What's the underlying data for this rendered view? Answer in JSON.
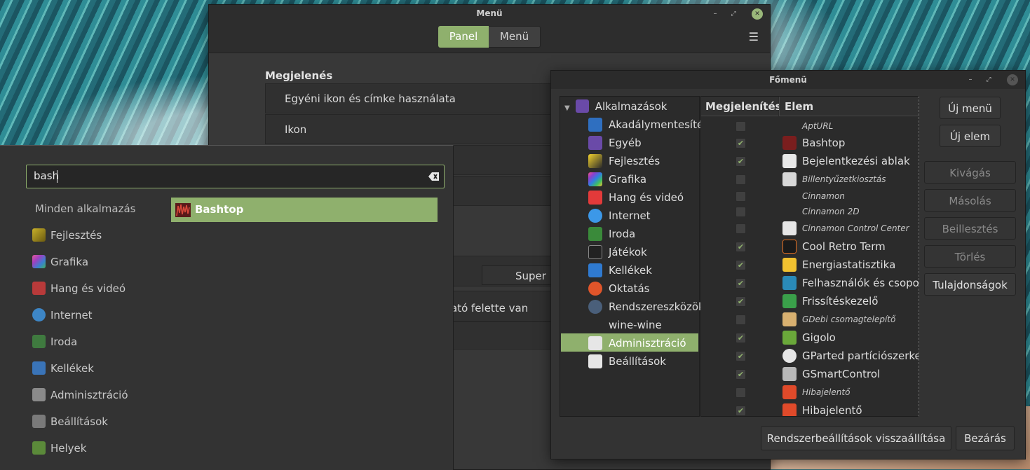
{
  "menu_window": {
    "title": "Menü",
    "tabs": [
      "Panel",
      "Menü"
    ],
    "section_title": "Megjelenés",
    "rows": [
      "Egyéni ikon és címke használata",
      "Ikon"
    ],
    "super_label": "Super L",
    "partial_text": "ató felette van"
  },
  "start_menu": {
    "search_value": "bash",
    "all_apps": "Minden alkalmazás",
    "categories": [
      "Fejlesztés",
      "Grafika",
      "Hang és videó",
      "Internet",
      "Iroda",
      "Kellékek",
      "Adminisztráció",
      "Beállítások",
      "Helyek"
    ],
    "result": "Bashtop"
  },
  "editor": {
    "title": "Főmenü",
    "tree_root": "Alkalmazások",
    "tree_items": [
      "Akadálymentesítés",
      "Egyéb",
      "Fejlesztés",
      "Grafika",
      "Hang és videó",
      "Internet",
      "Iroda",
      "Játékok",
      "Kellékek",
      "Oktatás",
      "Rendszereszközök",
      "wine-wine",
      "Adminisztráció",
      "Beállítások"
    ],
    "columns": [
      "Megjelenítés",
      "Elem"
    ],
    "items": [
      {
        "label": "AptURL",
        "checked": false,
        "italic": true
      },
      {
        "label": "Bashtop",
        "checked": true,
        "italic": false
      },
      {
        "label": "Bejelentkezési ablak",
        "checked": true,
        "italic": false
      },
      {
        "label": "Billentyűzetkiosztás",
        "checked": false,
        "italic": true
      },
      {
        "label": "Cinnamon",
        "checked": false,
        "italic": true
      },
      {
        "label": "Cinnamon 2D",
        "checked": false,
        "italic": true
      },
      {
        "label": "Cinnamon Control Center",
        "checked": false,
        "italic": true
      },
      {
        "label": "Cool Retro Term",
        "checked": true,
        "italic": false
      },
      {
        "label": "Energiastatisztika",
        "checked": true,
        "italic": false
      },
      {
        "label": "Felhasználók és csoportok",
        "checked": true,
        "italic": false
      },
      {
        "label": "Frissítéskezelő",
        "checked": true,
        "italic": false
      },
      {
        "label": "GDebi csomagtelepítő",
        "checked": false,
        "italic": true
      },
      {
        "label": "Gigolo",
        "checked": true,
        "italic": false
      },
      {
        "label": "GParted partíciószerkesztő",
        "checked": true,
        "italic": false
      },
      {
        "label": "GSmartControl",
        "checked": true,
        "italic": false
      },
      {
        "label": "Hibajelentő",
        "checked": false,
        "italic": true
      },
      {
        "label": "Hibajelentő",
        "checked": true,
        "italic": false
      }
    ],
    "buttons": {
      "new_menu": "Új menü",
      "new_item": "Új elem",
      "cut": "Kivágás",
      "copy": "Másolás",
      "paste": "Beillesztés",
      "delete": "Törlés",
      "properties": "Tulajdonságok",
      "restore": "Rendszerbeállítások visszaállítása",
      "close": "Bezárás"
    }
  }
}
